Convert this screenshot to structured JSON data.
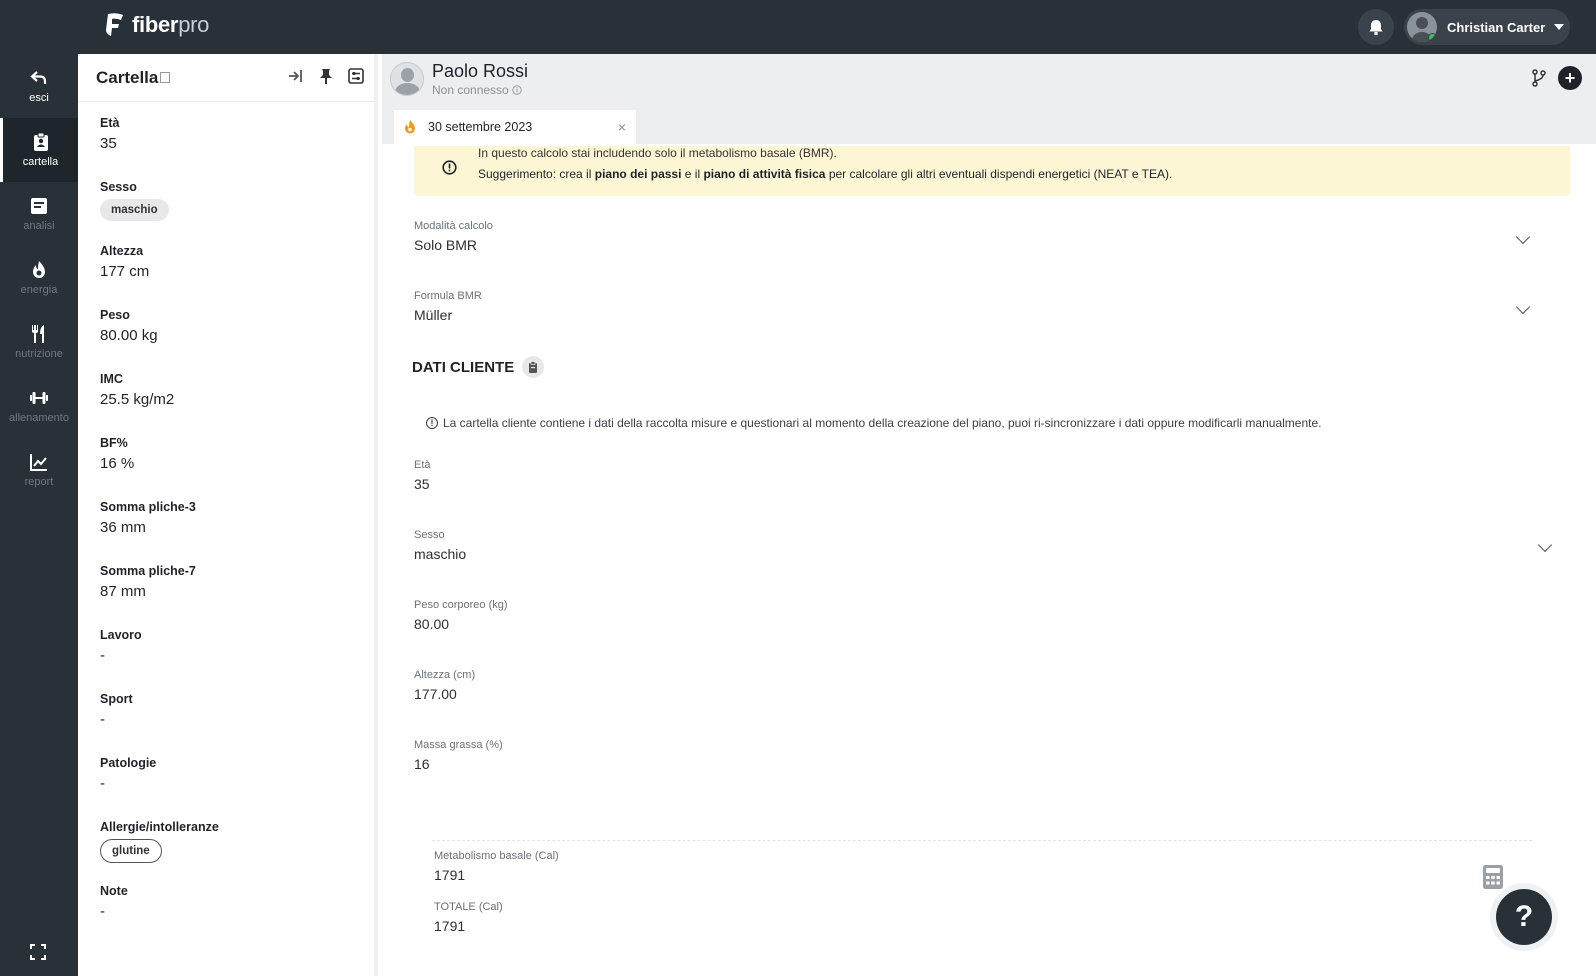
{
  "app": {
    "brand_a": "fiber",
    "brand_b": "pro"
  },
  "user": {
    "name": "Christian Carter"
  },
  "nav": [
    {
      "label": "esci",
      "icon": "back-arrow-icon"
    },
    {
      "label": "cartella",
      "icon": "clipboard-icon"
    },
    {
      "label": "analisi",
      "icon": "document-icon"
    },
    {
      "label": "energia",
      "icon": "flame-icon"
    },
    {
      "label": "nutrizione",
      "icon": "fork-knife-icon"
    },
    {
      "label": "allenamento",
      "icon": "dumbbell-icon"
    },
    {
      "label": "report",
      "icon": "chart-line-icon"
    }
  ],
  "sidebar": {
    "title": "Cartella",
    "fields": [
      {
        "label": "Età",
        "value": "35"
      },
      {
        "label": "Sesso",
        "chip": "maschio"
      },
      {
        "label": "Altezza",
        "value": "177 cm"
      },
      {
        "label": "Peso",
        "value": "80.00 kg"
      },
      {
        "label": "IMC",
        "value": "25.5 kg/m2"
      },
      {
        "label": "BF%",
        "value": "16 %"
      },
      {
        "label": "Somma pliche-3",
        "value": "36 mm"
      },
      {
        "label": "Somma pliche-7",
        "value": "87 mm"
      },
      {
        "label": "Lavoro",
        "value": "-"
      },
      {
        "label": "Sport",
        "value": "-"
      },
      {
        "label": "Patologie",
        "value": "-"
      },
      {
        "label": "Allergie/intolleranze",
        "chip": "glutine"
      },
      {
        "label": "Note",
        "value": "-"
      }
    ]
  },
  "client": {
    "name": "Paolo Rossi",
    "status": "Non connesso"
  },
  "tab": {
    "label": "30 settembre 2023",
    "close": "×"
  },
  "warning": {
    "line1": "In questo calcolo stai includendo solo il metabolismo basale (BMR).",
    "l2a": "Suggerimento: crea il ",
    "l2b": "piano dei passi",
    "l2c": " e il ",
    "l2d": "piano di attività fisica",
    "l2e": " per calcolare gli altri eventuali dispendi energetici (NEAT e TEA)."
  },
  "calc": {
    "mode_label": "Modalità calcolo",
    "mode_value": "Solo BMR",
    "formula_label": "Formula BMR",
    "formula_value": "Müller"
  },
  "section": {
    "title": "DATI CLIENTE",
    "info": "La cartella cliente contiene i dati della raccolta misure e questionari al momento della creazione del piano, puoi ri-sincronizzare i dati oppure modificarli manualmente."
  },
  "client_data": [
    {
      "label": "Età",
      "value": "35"
    },
    {
      "label": "Sesso",
      "value": "maschio"
    },
    {
      "label": "Peso corporeo (kg)",
      "value": "80.00"
    },
    {
      "label": "Altezza (cm)",
      "value": "177.00"
    },
    {
      "label": "Massa grassa (%)",
      "value": "16"
    }
  ],
  "results": [
    {
      "label": "Metabolismo basale (Cal)",
      "value": "1791"
    },
    {
      "label": "TOTALE (Cal)",
      "value": "1791"
    }
  ],
  "help": {
    "label": "?"
  }
}
